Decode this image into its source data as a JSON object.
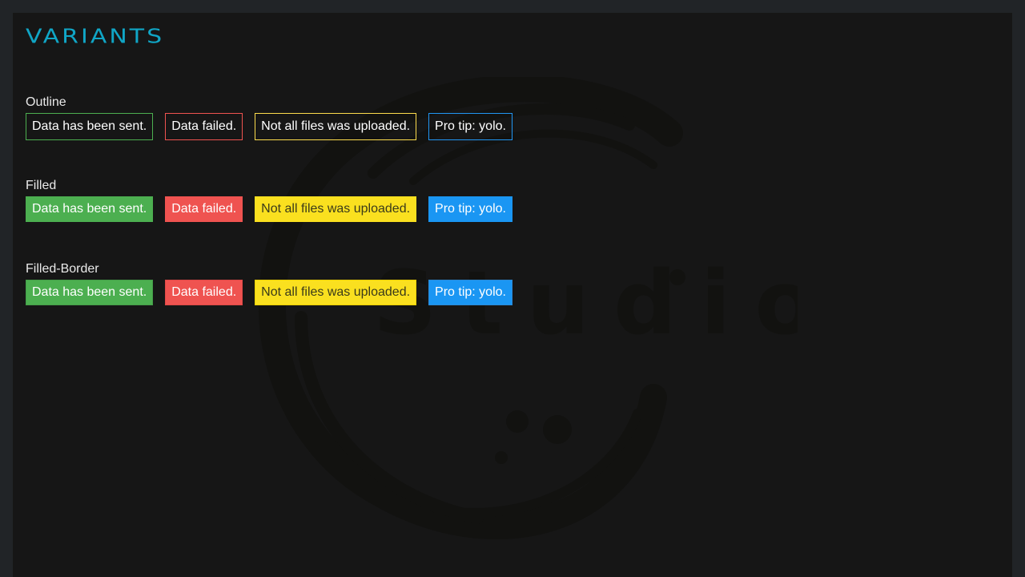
{
  "title": "Variants",
  "watermark_text": "Studio",
  "sections": [
    {
      "label": "Outline",
      "alerts": [
        {
          "text": "Data has been sent."
        },
        {
          "text": "Data failed."
        },
        {
          "text": "Not all files was uploaded."
        },
        {
          "text": "Pro tip: yolo."
        }
      ]
    },
    {
      "label": "Filled",
      "alerts": [
        {
          "text": "Data has been sent."
        },
        {
          "text": "Data failed."
        },
        {
          "text": "Not all files was uploaded."
        },
        {
          "text": "Pro tip: yolo."
        }
      ]
    },
    {
      "label": "Filled-Border",
      "alerts": [
        {
          "text": "Data has been sent."
        },
        {
          "text": "Data failed."
        },
        {
          "text": "Not all files was uploaded."
        },
        {
          "text": "Pro tip: yolo."
        }
      ]
    }
  ],
  "colors": {
    "background": "#212427",
    "panel": "#161616",
    "title": "#10a6c6",
    "success": "#4caf50",
    "error": "#ef5350",
    "warning": "#fae01f",
    "info": "#1a96f3"
  }
}
